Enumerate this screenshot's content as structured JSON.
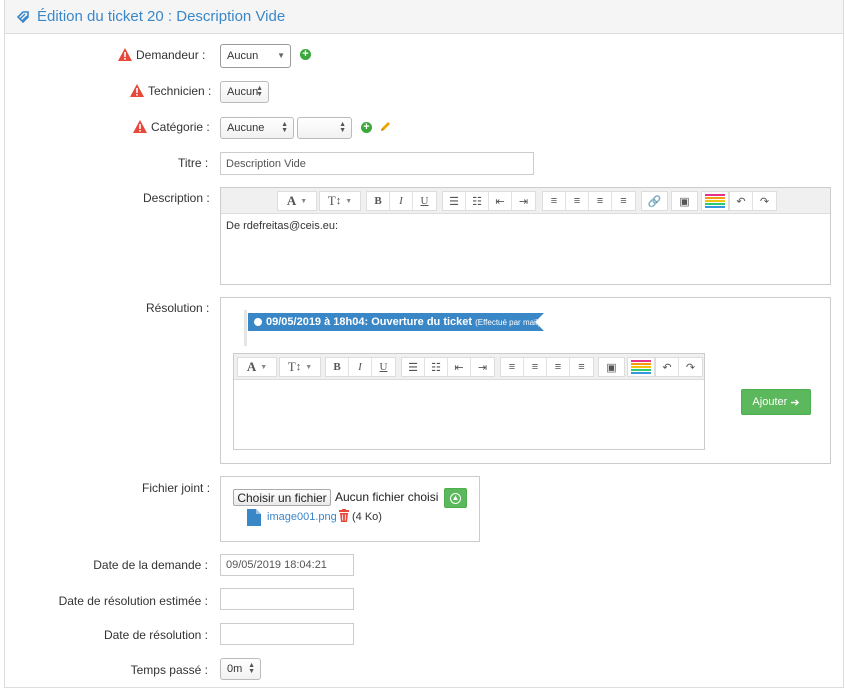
{
  "header": {
    "title": "Édition du ticket 20 : Description Vide"
  },
  "form": {
    "demandeur": {
      "label": "Demandeur :",
      "value": "Aucun"
    },
    "technicien": {
      "label": "Technicien :",
      "value": "Aucun"
    },
    "categorie": {
      "label": "Catégorie :",
      "value": "Aucune",
      "sub_value": ""
    },
    "titre": {
      "label": "Titre :",
      "value": "Description Vide"
    },
    "description": {
      "label": "Description :",
      "content": "De rdefreitas@ceis.eu:"
    },
    "resolution": {
      "label": "Résolution :",
      "timeline_entry": "09/05/2019 à 18h04: Ouverture du ticket",
      "timeline_note": "(Effectué par mail)",
      "add_button": "Ajouter"
    },
    "fichier": {
      "label": "Fichier joint :",
      "choose_button": "Choisir un fichier",
      "no_file": "Aucun fichier choisi",
      "attachment_name": "image001.png",
      "attachment_size": "(4 Ko)"
    },
    "date_demande": {
      "label": "Date de la demande :",
      "value": "09/05/2019 18:04:21"
    },
    "date_resolution_estimee": {
      "label": "Date de résolution estimée :",
      "value": ""
    },
    "date_resolution": {
      "label": "Date de résolution :",
      "value": ""
    },
    "temps_passe": {
      "label": "Temps passé :",
      "value": "0m"
    }
  },
  "toolbar": {
    "font": "A",
    "size": "T",
    "bold": "B",
    "italic": "I",
    "underline": "U"
  },
  "colors": {
    "accent": "#3a87c8",
    "success": "#5cb85c",
    "warning": "#e8483a",
    "pencil": "#f0a500"
  }
}
